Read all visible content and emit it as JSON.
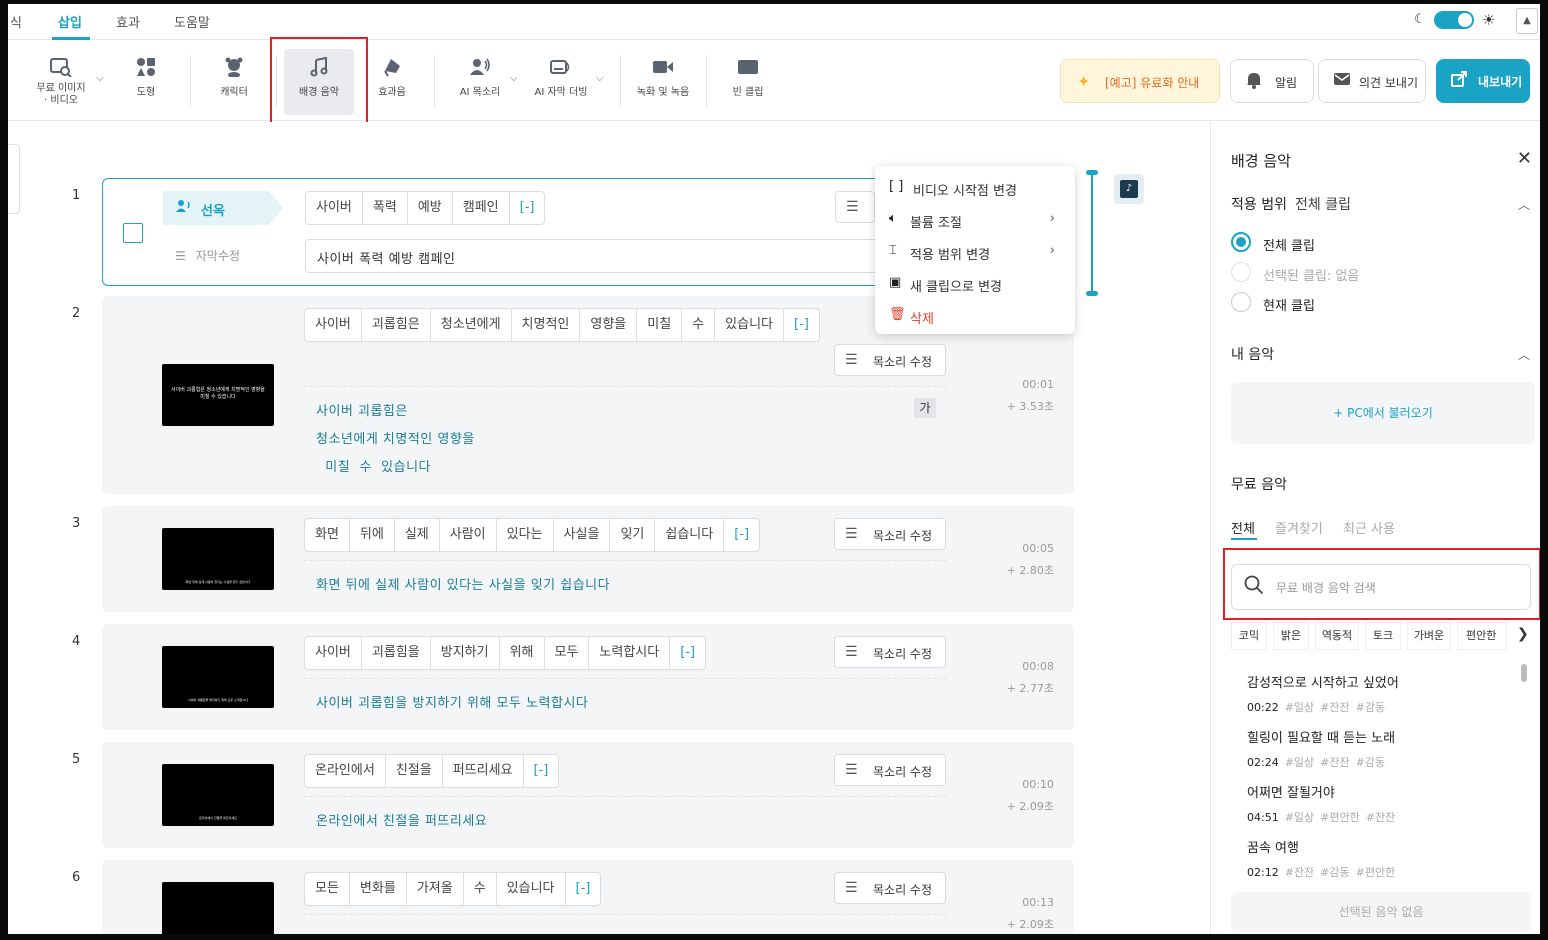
{
  "menu": {
    "items": [
      "식",
      "삽입",
      "효과",
      "도움말"
    ],
    "active": "삽입"
  },
  "toolbar": {
    "tools": [
      {
        "label": "무료 이미지\n· 비디오",
        "icon": "image-search-icon"
      },
      {
        "label": "도형",
        "icon": "shapes-icon"
      },
      {
        "label": "캐릭터",
        "icon": "character-icon"
      },
      {
        "label": "배경 음악",
        "icon": "music-note-icon"
      },
      {
        "label": "효과음",
        "icon": "sound-effect-icon"
      },
      {
        "label": "AI 목소리",
        "icon": "ai-voice-icon"
      },
      {
        "label": "AI 자막 더빙",
        "icon": "ai-subtitle-dub-icon"
      },
      {
        "label": "녹화 및 녹음",
        "icon": "video-record-icon"
      },
      {
        "label": "빈 클립",
        "icon": "blank-clip-icon"
      }
    ],
    "promo_label": "[예고] 유료화 안내",
    "notify_label": "알림",
    "feedback_label": "의견 보내기",
    "export_label": "내보내기"
  },
  "clips": [
    {
      "num": "1",
      "words": [
        "사이버",
        "폭력",
        "예방",
        "캠페인",
        "[-]"
      ],
      "caption": "사이버  폭력  예방  캠페인",
      "tag": "선옥",
      "sub_edit": "자막수정"
    },
    {
      "num": "2",
      "words": [
        "사이버",
        "괴롭힘은",
        "청소년에게",
        "치명적인",
        "영향을",
        "미칠",
        "수",
        "있습니다",
        "[-]"
      ],
      "lines": [
        "사이버  괴롭힘은",
        "청소년에게  치명적인  영향을",
        "  미칠  수  있습니다"
      ],
      "time": "00:01",
      "dur": "+  3.53초",
      "voice": "목소리 수정",
      "ga": "가",
      "thumb": "사이버 괴롭힘은 청소년에게 치명적인 영향을 미칠 수 있습니다"
    },
    {
      "num": "3",
      "words": [
        "화면",
        "뒤에",
        "실제",
        "사람이",
        "있다는",
        "사실을",
        "잊기",
        "쉽습니다",
        "[-]"
      ],
      "lines": [
        "화면  뒤에  실제  사람이  있다는  사실을  잊기  쉽습니다"
      ],
      "time": "00:05",
      "dur": "+  2.80초",
      "voice": "목소리 수정",
      "thumb": "화면 뒤에 실제 사람이 있다는 사실을 잊기 쉽습니다"
    },
    {
      "num": "4",
      "words": [
        "사이버",
        "괴롭힘을",
        "방지하기",
        "위해",
        "모두",
        "노력합시다",
        "[-]"
      ],
      "lines": [
        "사이버  괴롭힘을  방지하기  위해  모두  노력합시다"
      ],
      "time": "00:08",
      "dur": "+  2.77초",
      "voice": "목소리 수정",
      "thumb": "사이버 괴롭힘을 방지하기 위해 모두 노력합시다"
    },
    {
      "num": "5",
      "words": [
        "온라인에서",
        "친절을",
        "퍼뜨리세요",
        "[-]"
      ],
      "lines": [
        "온라인에서  친절을  퍼뜨리세요"
      ],
      "time": "00:10",
      "dur": "+  2.09초",
      "voice": "목소리 수정",
      "thumb": "온라인에서 친절을 퍼뜨리세요"
    },
    {
      "num": "6",
      "words": [
        "모든",
        "변화를",
        "가져올",
        "수",
        "있습니다",
        "[-]"
      ],
      "lines": [],
      "time": "00:13",
      "dur": "+  2.09초",
      "voice": "목소리 수정",
      "thumb": ""
    }
  ],
  "context_menu": [
    {
      "label": "비디오 시작점 변경",
      "icon": "bracket-icon"
    },
    {
      "label": "볼륨 조절",
      "icon": "volume-icon",
      "submenu": true
    },
    {
      "label": "적용 범위 변경",
      "icon": "range-icon",
      "submenu": true
    },
    {
      "label": "새 클립으로 변경",
      "icon": "new-clip-icon"
    },
    {
      "label": "삭제",
      "icon": "trash-icon",
      "danger": true
    }
  ],
  "panel": {
    "title": "배경 음악",
    "scope_label": "적용 범위",
    "scope_value": "전체 클립",
    "scope_options": [
      {
        "label": "전체 클립",
        "selected": true,
        "disabled": false
      },
      {
        "label": "선택된 클립: 없음",
        "selected": false,
        "disabled": true
      },
      {
        "label": "현재 클립",
        "selected": false,
        "disabled": false
      }
    ],
    "my_music_label": "내 음악",
    "load_pc_label": "+   PC에서 불러오기",
    "free_music_label": "무료 음악",
    "tabs": [
      "전체",
      "즐겨찾기",
      "최근 사용"
    ],
    "search_placeholder": "무료 배경 음악 검색",
    "chips": [
      "코믹",
      "밝은",
      "역동적",
      "토크",
      "가벼운",
      "편안한"
    ],
    "songs": [
      {
        "title": "감성적으로 시작하고 싶었어",
        "duration": "00:22",
        "tags": [
          "#일상",
          "#잔잔",
          "#감동"
        ]
      },
      {
        "title": "힐링이 필요할 때 듣는 노래",
        "duration": "02:24",
        "tags": [
          "#일상",
          "#잔잔",
          "#감동"
        ]
      },
      {
        "title": "어쩌면 잘될거야",
        "duration": "04:51",
        "tags": [
          "#일상",
          "#편안한",
          "#잔잔"
        ]
      },
      {
        "title": "꿈속 여행",
        "duration": "02:12",
        "tags": [
          "#잔잔",
          "#감동",
          "#편안한"
        ]
      }
    ],
    "none_selected_label": "선택된 음악 없음"
  }
}
